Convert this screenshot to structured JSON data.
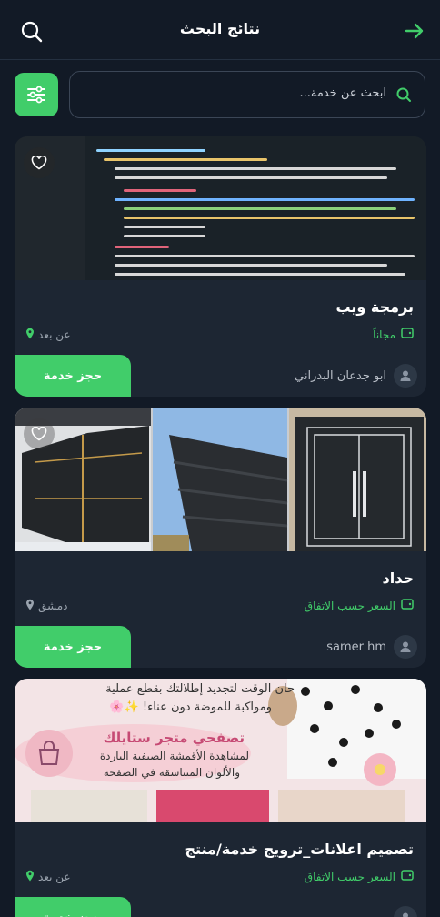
{
  "header": {
    "title": "نتائج البحث"
  },
  "search": {
    "placeholder": "ابحث عن خدمة..."
  },
  "cards": [
    {
      "name": "برمجة ويب",
      "price": "مجاناً",
      "location": "عن بعد",
      "provider": "ابو جدعان البدراني",
      "book_label": "حجز خدمة"
    },
    {
      "name": "حداد",
      "price": "السعر حسب الاتفاق",
      "location": "دمشق",
      "provider": "samer hm",
      "book_label": "حجز خدمة"
    },
    {
      "name": "تصميم اعلانات_ترويج خدمة/منتج",
      "price": "السعر حسب الاتفاق",
      "location": "عن بعد",
      "provider": "",
      "book_label": "حجز خدمة",
      "promo_line1": "حان الوقت لتجديد إطلالتك بقطع عملية",
      "promo_line2": "ومواكبة للموضة دون عناء! ✨🌸",
      "promo_title": "تصفحي متجر ستايلك",
      "promo_line3": "لمشاهدة الأقمشة الصيفية الباردة",
      "promo_line4": "والألوان المتناسقة في الصفحة"
    }
  ],
  "colors": {
    "accent": "#41cd6a",
    "background": "#121a26",
    "card": "#1d2633"
  }
}
